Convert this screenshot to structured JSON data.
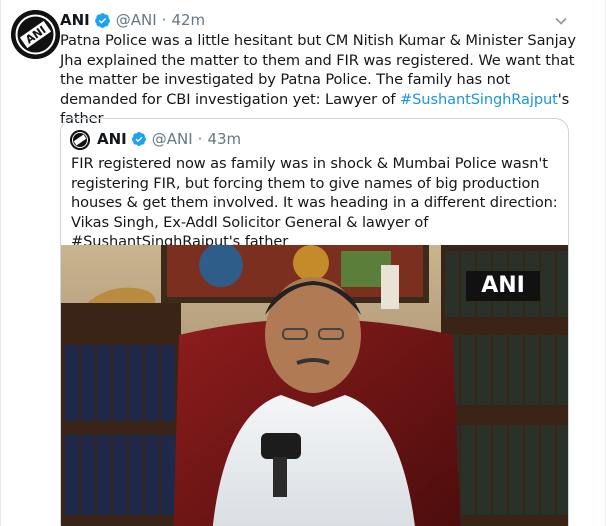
{
  "tweet": {
    "name": "ANI",
    "handle": "@ANI",
    "separator": "·",
    "time": "42m",
    "text_before_hashtag": "Patna Police was a little hesitant but CM Nitish Kumar & Minister Sanjay Jha explained the matter to them and FIR was registered. We want that the matter be investigated by Patna Police. The family has not demanded for CBI investigation yet: Lawyer of ",
    "hashtag": "#SushantSinghRajput",
    "text_after_hashtag": "'s father"
  },
  "quoted_tweet": {
    "name": "ANI",
    "handle": "@ANI",
    "separator": "·",
    "time": "43m",
    "text": "FIR registered now as family was in shock & Mumbai Police wasn't registering FIR, but forcing them to give names of big production houses & get them involved. It was heading in a different direction: Vikas Singh, Ex-Addl Solicitor General & lawyer of #SushantSinghRajput's father",
    "media_watermark": "ANI"
  },
  "colors": {
    "text": "#14171a",
    "secondary": "#657786",
    "link": "#1b95e0",
    "verified": "#1da1f2",
    "border": "#ccd6dd"
  },
  "icons": {
    "verified": "verified-badge-icon",
    "caret": "chevron-down-icon",
    "avatar": "ani-logo-avatar"
  }
}
